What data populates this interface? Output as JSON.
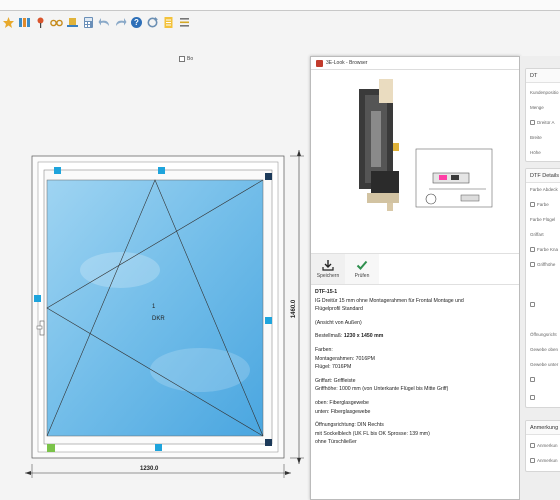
{
  "checkbox_label": "Bo",
  "toolbar_icons": [
    "star-icon",
    "frame-icon",
    "pin-icon",
    "glasses-icon",
    "hat-icon",
    "calculator-icon",
    "undo-icon",
    "redo-icon",
    "help-icon",
    "refresh-icon",
    "document-icon",
    "list-icon"
  ],
  "drawing": {
    "width_label": "1230.0",
    "height_label": "1460.0",
    "sash_number": "1",
    "sash_type": "DKR"
  },
  "browser": {
    "title": "3E-Look - Browser",
    "actions": {
      "save": "Speichern",
      "check": "Prüfen"
    },
    "description": {
      "title": "DTF-15-1",
      "line1": "IG Dreitür 15 mm ohne Montagerahmen für Frontal Montage und",
      "line2": "Flügelprofil Standard",
      "view": "(Ansicht von Außen)",
      "order_prefix": "Bestellmaß: ",
      "order_value": "1230 x 1450 mm",
      "colors_h": "Farben:",
      "colors_frame": "Montagerahmen: 7016PM",
      "colors_sash": "Flügel: 7016PM",
      "handle_type": "Griffart: Griffleiste",
      "handle_height": "Griffhöhe: 1000 mm (von Unterkante Flügel bis Mitte Griff)",
      "top": "oben: Fiberglasgewebe",
      "bottom": "unten: Fiberglasgewebe",
      "opening": "Öffnungsrichtung: DIN Rechts",
      "plinth": "mit Sockelblech (UK FL bis OK Sprosse: 139 mm)",
      "closer": "ohne Türschließer"
    }
  },
  "right_panel": {
    "dt": {
      "header": "DT",
      "customer_position": "Kundenpositio",
      "quantity": "Menge",
      "doorstop": "Dreitür A",
      "width": "Breite",
      "height": "Höhe"
    },
    "dtf": {
      "header": "DTF Details",
      "color_cover": "Farbe Abdeck",
      "color": "Farbe",
      "color_sash": "Farbe Flügel",
      "handle": "Griffart",
      "color_handle": "Farbe Kna",
      "handle_height": "Griffhöhe",
      "opening": "Öffnungsricht",
      "mesh_top": "Gewebe oben",
      "mesh_bottom": "Gewebe unter"
    },
    "notes": {
      "header": "Anmerkung",
      "item1": "Anmerkun",
      "item2": "Anmerkun"
    }
  },
  "colors": {
    "glass_light": "#9fd4f2",
    "glass_dark": "#4aa6e0",
    "marker_blue": "#1ea4dc",
    "marker_navy": "#1c3a5a",
    "marker_green": "#7bc34a",
    "check_green": "#2f8f4e"
  }
}
